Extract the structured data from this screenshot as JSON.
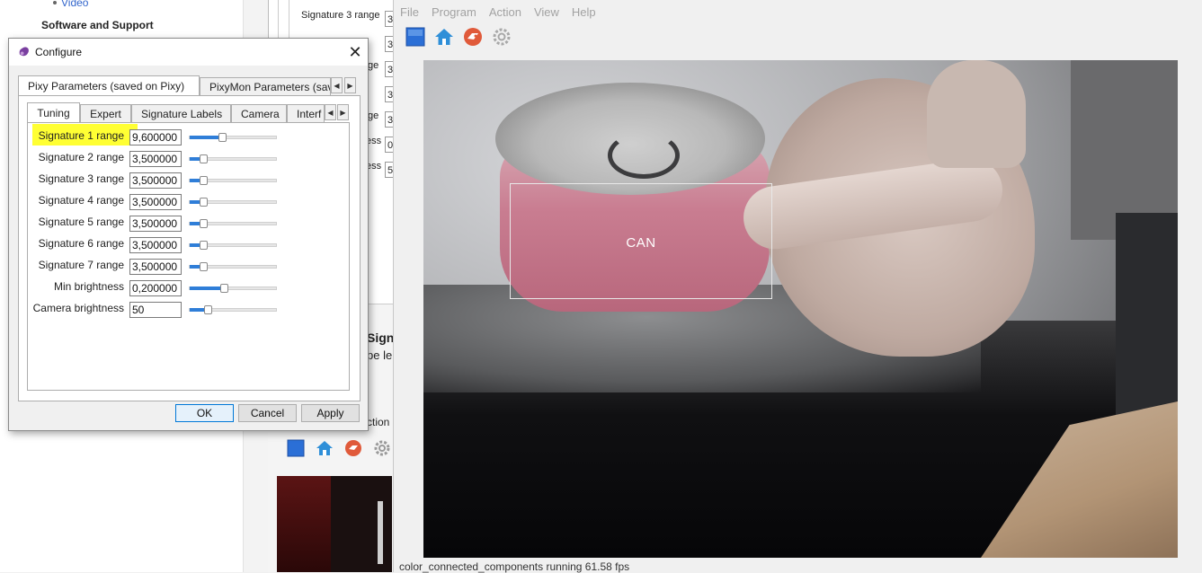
{
  "background_page": {
    "video_link": "Video",
    "heading": "Software and Support"
  },
  "background_pixymon": {
    "rows": [
      {
        "label": "Signature 3 range",
        "value": "3"
      },
      {
        "label": "",
        "value": "3"
      },
      {
        "label": "ge",
        "value": "3"
      },
      {
        "label": "",
        "value": "3"
      },
      {
        "label": "ge",
        "value": "3"
      },
      {
        "label": "ess",
        "value": "0"
      },
      {
        "label": "ess",
        "value": "5"
      }
    ],
    "sign_heading": "Sign",
    "sign_text": "pe le",
    "action_fragment": "ction"
  },
  "main_window": {
    "menu": [
      "File",
      "Program",
      "Action",
      "View",
      "Help"
    ],
    "video_label": "CAN",
    "status": "color_connected_components running 61.58 fps",
    "colors": {
      "toolbar_blue": "#2b6fd6",
      "home_blue": "#2f8fd8",
      "stop_red": "#e05a3a",
      "gear_gray": "#9a9a9a"
    }
  },
  "dialog": {
    "title": "Configure",
    "close_glyph": "✕",
    "outer_tabs": [
      "Pixy Parameters (saved on Pixy)",
      "PixyMon Parameters (sav"
    ],
    "inner_tabs": [
      "Tuning",
      "Expert",
      "Signature Labels",
      "Camera",
      "Interf"
    ],
    "arrow_left": "◀",
    "arrow_right": "▶",
    "params": [
      {
        "label": "Signature 1 range",
        "value": "9,600000",
        "level": 0.37,
        "highlighted": true
      },
      {
        "label": "Signature 2 range",
        "value": "3,500000",
        "level": 0.16,
        "highlighted": false
      },
      {
        "label": "Signature 3 range",
        "value": "3,500000",
        "level": 0.16,
        "highlighted": false
      },
      {
        "label": "Signature 4 range",
        "value": "3,500000",
        "level": 0.16,
        "highlighted": false
      },
      {
        "label": "Signature 5 range",
        "value": "3,500000",
        "level": 0.16,
        "highlighted": false
      },
      {
        "label": "Signature 6 range",
        "value": "3,500000",
        "level": 0.16,
        "highlighted": false
      },
      {
        "label": "Signature 7 range",
        "value": "3,500000",
        "level": 0.16,
        "highlighted": false
      },
      {
        "label": "Min brightness",
        "value": "0,200000",
        "level": 0.4,
        "highlighted": false
      },
      {
        "label": "Camera brightness",
        "value": "50",
        "level": 0.21,
        "highlighted": false
      }
    ],
    "buttons": {
      "ok": "OK",
      "cancel": "Cancel",
      "apply": "Apply"
    },
    "highlight_color": "#ffff33"
  }
}
